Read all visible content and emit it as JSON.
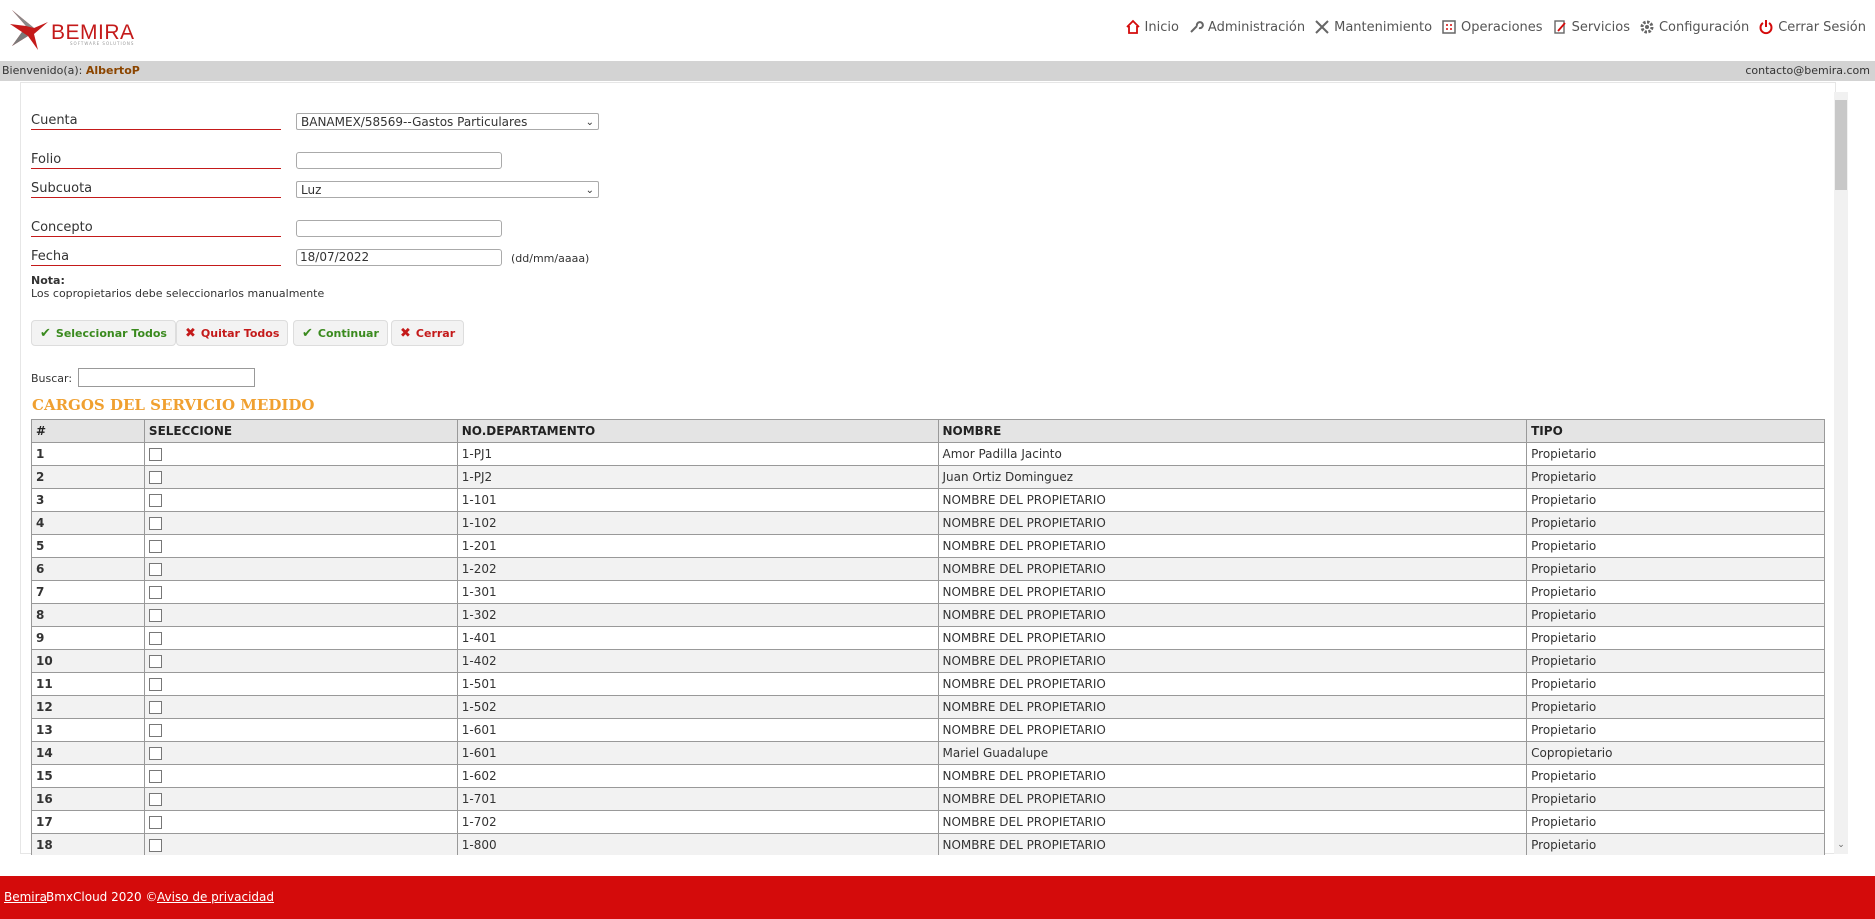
{
  "brand": {
    "name": "BEMIRA",
    "tagline": "SOFTWARE SOLUTIONS"
  },
  "nav": [
    {
      "label": "Inicio",
      "icon": "home-icon"
    },
    {
      "label": "Administración",
      "icon": "wrench-icon"
    },
    {
      "label": "Mantenimiento",
      "icon": "tools-icon"
    },
    {
      "label": "Operaciones",
      "icon": "calculator-icon"
    },
    {
      "label": "Servicios",
      "icon": "edit-icon"
    },
    {
      "label": "Configuración",
      "icon": "gear-icon"
    },
    {
      "label": "Cerrar Sesión",
      "icon": "power-icon"
    }
  ],
  "welcome": {
    "prefix": "Bienvenido(a):",
    "user": "AlbertoP",
    "email": "contacto@bemira.com"
  },
  "form": {
    "cuenta_label": "Cuenta",
    "cuenta_value": "BANAMEX/58569--Gastos Particulares",
    "folio_label": "Folio",
    "folio_value": "",
    "subcuota_label": "Subcuota",
    "subcuota_value": "Luz",
    "concepto_label": "Concepto",
    "concepto_value": "",
    "fecha_label": "Fecha",
    "fecha_value": "18/07/2022",
    "fecha_hint": "(dd/mm/aaaa)",
    "nota_title": "Nota:",
    "nota_text": "Los copropietarios debe seleccionarlos manualmente"
  },
  "buttons": {
    "select_all": "Seleccionar Todos",
    "remove_all": "Quitar Todos",
    "continue": "Continuar",
    "close": "Cerrar"
  },
  "search": {
    "label": "Buscar:"
  },
  "section_title": "CARGOS DEL SERVICIO MEDIDO",
  "table": {
    "headers": [
      "#",
      "SELECCIONE",
      "NO.DEPARTAMENTO",
      "NOMBRE",
      "TIPO"
    ],
    "rows": [
      {
        "num": "1",
        "dept": "1-PJ1",
        "name": "Amor Padilla Jacinto",
        "type": "Propietario"
      },
      {
        "num": "2",
        "dept": "1-PJ2",
        "name": "Juan Ortiz Dominguez",
        "type": "Propietario"
      },
      {
        "num": "3",
        "dept": "1-101",
        "name": "NOMBRE DEL PROPIETARIO",
        "type": "Propietario"
      },
      {
        "num": "4",
        "dept": "1-102",
        "name": "NOMBRE DEL PROPIETARIO",
        "type": "Propietario"
      },
      {
        "num": "5",
        "dept": "1-201",
        "name": "NOMBRE DEL PROPIETARIO",
        "type": "Propietario"
      },
      {
        "num": "6",
        "dept": "1-202",
        "name": "NOMBRE DEL PROPIETARIO",
        "type": "Propietario"
      },
      {
        "num": "7",
        "dept": "1-301",
        "name": "NOMBRE DEL PROPIETARIO",
        "type": "Propietario"
      },
      {
        "num": "8",
        "dept": "1-302",
        "name": "NOMBRE DEL PROPIETARIO",
        "type": "Propietario"
      },
      {
        "num": "9",
        "dept": "1-401",
        "name": "NOMBRE DEL PROPIETARIO",
        "type": "Propietario"
      },
      {
        "num": "10",
        "dept": "1-402",
        "name": "NOMBRE DEL PROPIETARIO",
        "type": "Propietario"
      },
      {
        "num": "11",
        "dept": "1-501",
        "name": "NOMBRE DEL PROPIETARIO",
        "type": "Propietario"
      },
      {
        "num": "12",
        "dept": "1-502",
        "name": "NOMBRE DEL PROPIETARIO",
        "type": "Propietario"
      },
      {
        "num": "13",
        "dept": "1-601",
        "name": "NOMBRE DEL PROPIETARIO",
        "type": "Propietario"
      },
      {
        "num": "14",
        "dept": "1-601",
        "name": "Mariel Guadalupe",
        "type": "Copropietario"
      },
      {
        "num": "15",
        "dept": "1-602",
        "name": "NOMBRE DEL PROPIETARIO",
        "type": "Propietario"
      },
      {
        "num": "16",
        "dept": "1-701",
        "name": "NOMBRE DEL PROPIETARIO",
        "type": "Propietario"
      },
      {
        "num": "17",
        "dept": "1-702",
        "name": "NOMBRE DEL PROPIETARIO",
        "type": "Propietario"
      },
      {
        "num": "18",
        "dept": "1-800",
        "name": "NOMBRE DEL PROPIETARIO",
        "type": "Propietario"
      }
    ]
  },
  "footer": {
    "brand_link": "Bemira",
    "text": "BmxCloud 2020 ©",
    "privacy_link": "Aviso de privacidad"
  },
  "colors": {
    "brand_red": "#d40b0b",
    "section_orange": "#f0a030",
    "user_brown": "#8b4500"
  }
}
